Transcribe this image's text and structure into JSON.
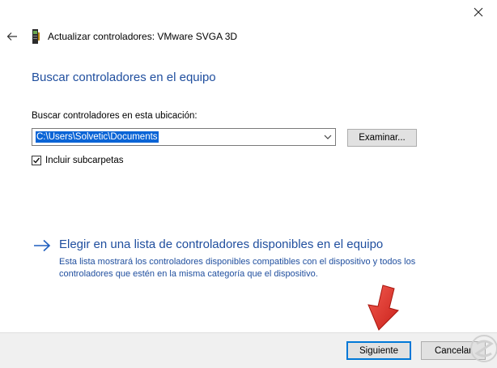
{
  "window": {
    "title": "Actualizar controladores: VMware SVGA 3D",
    "close_icon": "close-icon",
    "back_icon": "back-arrow-icon",
    "device_icon": "display-adapter-icon"
  },
  "main": {
    "heading": "Buscar controladores en el equipo",
    "location_label": "Buscar controladores en esta ubicación:",
    "location_value": "C:\\Users\\Solvetic\\Documents",
    "browse_label": "Examinar...",
    "include_subfolders_label": "Incluir subcarpetas",
    "include_subfolders_checked": true
  },
  "pick": {
    "link": "Elegir en una lista de controladores disponibles en el equipo",
    "description": "Esta lista mostrará los controladores disponibles compatibles con el dispositivo y todos los controladores que estén en la misma categoría que el dispositivo."
  },
  "footer": {
    "next_label": "Siguiente",
    "cancel_label": "Cancelar"
  },
  "colors": {
    "accent": "#1f4e9e",
    "selection": "#0a64d6",
    "focus_border": "#0078d7",
    "annotation_arrow": "#e5322b"
  }
}
